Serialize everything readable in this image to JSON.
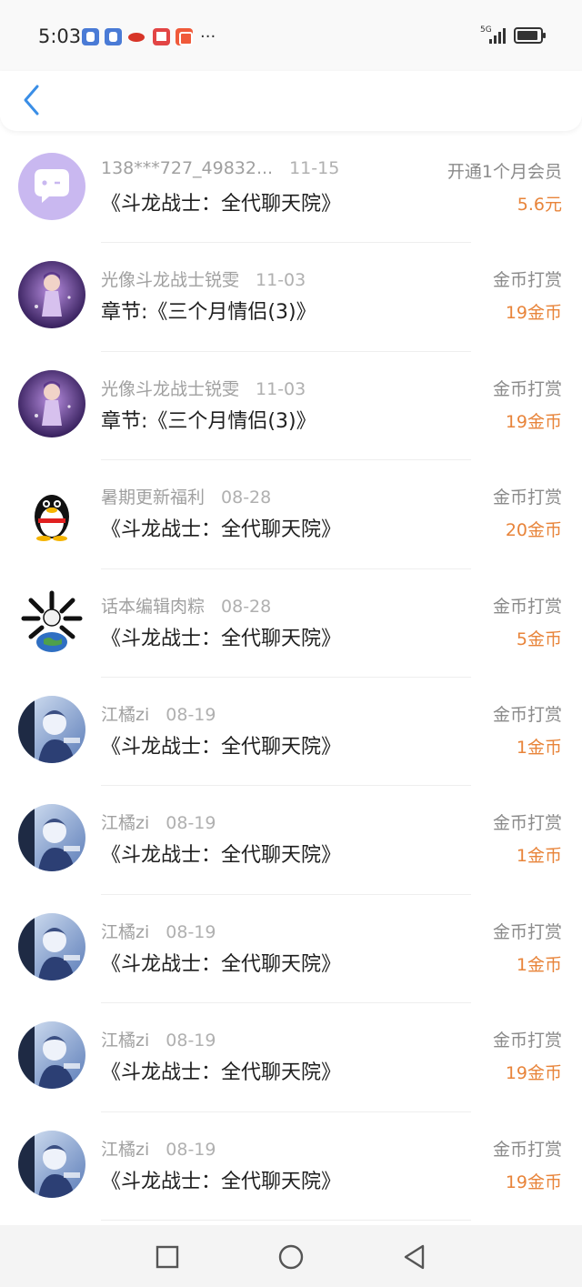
{
  "status_bar": {
    "time": "5:03",
    "notification_icons": [
      "qq-browser-icon",
      "qq-browser-icon",
      "weibo-icon",
      "reader-app-icon",
      "kuaishou-icon"
    ],
    "overflow": "···",
    "network_label": "5G"
  },
  "header": {
    "back_icon": "chevron-left-icon",
    "accent_color": "#3a8ee6"
  },
  "records": [
    {
      "name": "138***727_49832...",
      "date": "11-15",
      "title": "《斗龙战士：全代聊天院》",
      "type": "开通1个月会员",
      "amount": "5.6元",
      "avatar": "chat-bubble-avatar"
    },
    {
      "name": "光像斗龙战士锐雯",
      "date": "11-03",
      "title": "章节:《三个月情侣(3)》",
      "type": "金币打赏",
      "amount": "19金币",
      "avatar": "anime-girl-purple-avatar"
    },
    {
      "name": "光像斗龙战士锐雯",
      "date": "11-03",
      "title": "章节:《三个月情侣(3)》",
      "type": "金币打赏",
      "amount": "19金币",
      "avatar": "anime-girl-purple-avatar"
    },
    {
      "name": "暑期更新福利",
      "date": "08-28",
      "title": "《斗龙战士：全代聊天院》",
      "type": "金币打赏",
      "amount": "20金币",
      "avatar": "qq-penguin-avatar"
    },
    {
      "name": "话本编辑肉粽",
      "date": "08-28",
      "title": "《斗龙战士：全代聊天院》",
      "type": "金币打赏",
      "amount": "5金币",
      "avatar": "earth-bones-avatar"
    },
    {
      "name": "江橘zi",
      "date": "08-19",
      "title": "《斗龙战士：全代聊天院》",
      "type": "金币打赏",
      "amount": "1金币",
      "avatar": "anime-boy-blue-avatar"
    },
    {
      "name": "江橘zi",
      "date": "08-19",
      "title": "《斗龙战士：全代聊天院》",
      "type": "金币打赏",
      "amount": "1金币",
      "avatar": "anime-boy-blue-avatar"
    },
    {
      "name": "江橘zi",
      "date": "08-19",
      "title": "《斗龙战士：全代聊天院》",
      "type": "金币打赏",
      "amount": "1金币",
      "avatar": "anime-boy-blue-avatar"
    },
    {
      "name": "江橘zi",
      "date": "08-19",
      "title": "《斗龙战士：全代聊天院》",
      "type": "金币打赏",
      "amount": "19金币",
      "avatar": "anime-boy-blue-avatar"
    },
    {
      "name": "江橘zi",
      "date": "08-19",
      "title": "《斗龙战士：全代聊天院》",
      "type": "金币打赏",
      "amount": "19金币",
      "avatar": "anime-boy-blue-avatar"
    }
  ],
  "nav_bar": {
    "buttons": [
      "recents-square-icon",
      "home-circle-icon",
      "back-triangle-icon"
    ]
  },
  "colors": {
    "amount": "#e8843a",
    "meta": "#a0a0a0",
    "title": "#1f1f1f"
  }
}
